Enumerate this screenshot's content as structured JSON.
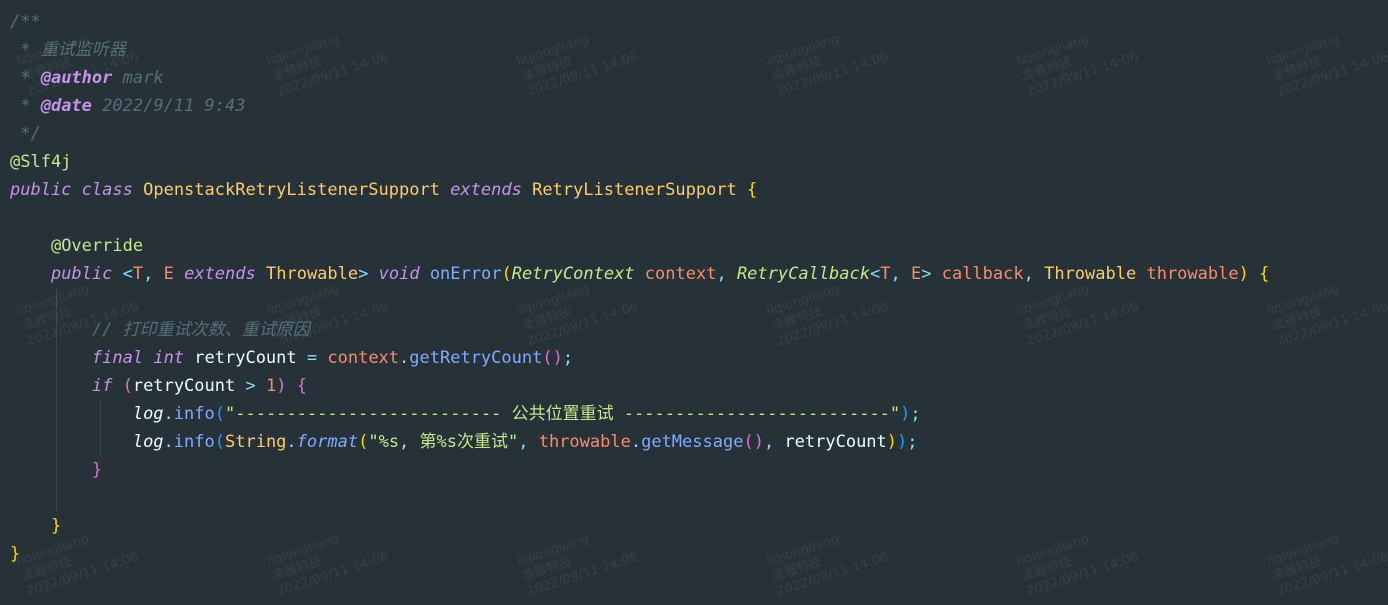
{
  "watermark": {
    "user": "liqiongliang",
    "org": "凌雅特技",
    "time": "2022/09/11 14:06"
  },
  "code_lines": [
    [
      {
        "t": "/**",
        "c": "comment"
      }
    ],
    [
      {
        "t": " * 重试监听器",
        "c": "comment"
      }
    ],
    [
      {
        "t": " * ",
        "c": "comment"
      },
      {
        "t": "@author",
        "c": "tag"
      },
      {
        "t": " mark",
        "c": "comment"
      }
    ],
    [
      {
        "t": " * ",
        "c": "comment"
      },
      {
        "t": "@date",
        "c": "tag"
      },
      {
        "t": " 2022/9/11 9:43",
        "c": "comment"
      }
    ],
    [
      {
        "t": " */",
        "c": "comment"
      }
    ],
    [
      {
        "t": "@Slf4j",
        "c": "ann"
      }
    ],
    [
      {
        "t": "public",
        "c": "kw"
      },
      {
        "t": " ",
        "c": "plain"
      },
      {
        "t": "class",
        "c": "kw"
      },
      {
        "t": " ",
        "c": "plain"
      },
      {
        "t": "OpenstackRetryListenerSupport",
        "c": "type"
      },
      {
        "t": " ",
        "c": "plain"
      },
      {
        "t": "extends",
        "c": "kw"
      },
      {
        "t": " ",
        "c": "plain"
      },
      {
        "t": "RetryListenerSupport",
        "c": "type"
      },
      {
        "t": " {",
        "c": "bracket-y"
      }
    ],
    [
      {
        "t": "",
        "c": "plain"
      }
    ],
    [
      {
        "t": "    ",
        "c": "plain"
      },
      {
        "t": "@Override",
        "c": "ann"
      }
    ],
    [
      {
        "t": "    ",
        "c": "plain"
      },
      {
        "t": "public",
        "c": "kw"
      },
      {
        "t": " <",
        "c": "punct"
      },
      {
        "t": "T",
        "c": "param"
      },
      {
        "t": ", ",
        "c": "punct"
      },
      {
        "t": "E",
        "c": "param"
      },
      {
        "t": " ",
        "c": "plain"
      },
      {
        "t": "extends",
        "c": "kw"
      },
      {
        "t": " ",
        "c": "plain"
      },
      {
        "t": "Throwable",
        "c": "type"
      },
      {
        "t": "> ",
        "c": "punct"
      },
      {
        "t": "void",
        "c": "kw"
      },
      {
        "t": " ",
        "c": "plain"
      },
      {
        "t": "onError",
        "c": "method"
      },
      {
        "t": "(",
        "c": "bracket-y"
      },
      {
        "t": "RetryContext",
        "c": "ann-italic"
      },
      {
        "t": " ",
        "c": "plain"
      },
      {
        "t": "context",
        "c": "param"
      },
      {
        "t": ", ",
        "c": "punct"
      },
      {
        "t": "RetryCallback",
        "c": "ann-italic"
      },
      {
        "t": "<",
        "c": "punct"
      },
      {
        "t": "T",
        "c": "param"
      },
      {
        "t": ", ",
        "c": "punct"
      },
      {
        "t": "E",
        "c": "param"
      },
      {
        "t": "> ",
        "c": "punct"
      },
      {
        "t": "callback",
        "c": "param"
      },
      {
        "t": ", ",
        "c": "punct"
      },
      {
        "t": "Throwable",
        "c": "type"
      },
      {
        "t": " ",
        "c": "plain"
      },
      {
        "t": "throwable",
        "c": "param"
      },
      {
        "t": ")",
        "c": "bracket-y"
      },
      {
        "t": " {",
        "c": "bracket-y"
      }
    ],
    [
      {
        "t": "",
        "c": "plain"
      }
    ],
    [
      {
        "t": "        ",
        "c": "plain"
      },
      {
        "t": "// 打印重试次数、重试原因",
        "c": "comment"
      }
    ],
    [
      {
        "t": "        ",
        "c": "plain"
      },
      {
        "t": "final",
        "c": "kw"
      },
      {
        "t": " ",
        "c": "plain"
      },
      {
        "t": "int",
        "c": "kw"
      },
      {
        "t": " retryCount ",
        "c": "plain"
      },
      {
        "t": "=",
        "c": "punct"
      },
      {
        "t": " ",
        "c": "plain"
      },
      {
        "t": "context",
        "c": "param"
      },
      {
        "t": ".",
        "c": "punct"
      },
      {
        "t": "getRetryCount",
        "c": "method"
      },
      {
        "t": "()",
        "c": "bracket-p"
      },
      {
        "t": ";",
        "c": "punct"
      }
    ],
    [
      {
        "t": "        ",
        "c": "plain"
      },
      {
        "t": "if",
        "c": "kw"
      },
      {
        "t": " ",
        "c": "plain"
      },
      {
        "t": "(",
        "c": "bracket-p"
      },
      {
        "t": "retryCount ",
        "c": "plain"
      },
      {
        "t": ">",
        "c": "punct"
      },
      {
        "t": " ",
        "c": "plain"
      },
      {
        "t": "1",
        "c": "num"
      },
      {
        "t": ")",
        "c": "bracket-p"
      },
      {
        "t": " {",
        "c": "bracket-p"
      }
    ],
    [
      {
        "t": "            ",
        "c": "plain"
      },
      {
        "t": "log",
        "c": "plain-italic"
      },
      {
        "t": ".",
        "c": "punct"
      },
      {
        "t": "info",
        "c": "method"
      },
      {
        "t": "(",
        "c": "bracket-b"
      },
      {
        "t": "\"-------------------------- 公共位置重试 --------------------------\"",
        "c": "str"
      },
      {
        "t": ")",
        "c": "bracket-b"
      },
      {
        "t": ";",
        "c": "punct"
      }
    ],
    [
      {
        "t": "            ",
        "c": "plain"
      },
      {
        "t": "log",
        "c": "plain-italic"
      },
      {
        "t": ".",
        "c": "punct"
      },
      {
        "t": "info",
        "c": "method"
      },
      {
        "t": "(",
        "c": "bracket-b"
      },
      {
        "t": "String",
        "c": "type"
      },
      {
        "t": ".",
        "c": "punct"
      },
      {
        "t": "format",
        "c": "method-italic"
      },
      {
        "t": "(",
        "c": "bracket-y"
      },
      {
        "t": "\"%s, 第%s次重试\"",
        "c": "str"
      },
      {
        "t": ", ",
        "c": "punct"
      },
      {
        "t": "throwable",
        "c": "param"
      },
      {
        "t": ".",
        "c": "punct"
      },
      {
        "t": "getMessage",
        "c": "method"
      },
      {
        "t": "()",
        "c": "bracket-p"
      },
      {
        "t": ", ",
        "c": "punct"
      },
      {
        "t": "retryCount",
        "c": "plain"
      },
      {
        "t": ")",
        "c": "bracket-y"
      },
      {
        "t": ")",
        "c": "bracket-b"
      },
      {
        "t": ";",
        "c": "punct"
      }
    ],
    [
      {
        "t": "        ",
        "c": "plain"
      },
      {
        "t": "}",
        "c": "bracket-p"
      }
    ],
    [
      {
        "t": "",
        "c": "plain"
      }
    ],
    [
      {
        "t": "    ",
        "c": "plain"
      },
      {
        "t": "}",
        "c": "bracket-y"
      }
    ],
    [
      {
        "t": "}",
        "c": "bracket-y"
      }
    ]
  ]
}
